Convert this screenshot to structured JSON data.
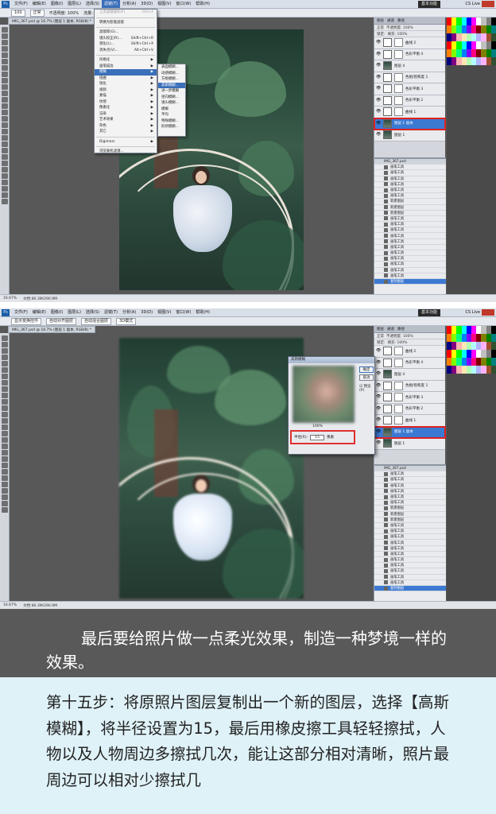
{
  "screenshot1": {
    "menu": [
      "文件(F)",
      "编辑(E)",
      "图像(I)",
      "图层(L)",
      "选择(S)",
      "滤镜(T)",
      "分析(A)",
      "3D(D)",
      "视图(V)",
      "窗口(W)",
      "帮助(H)"
    ],
    "active_menu": "滤镜(T)",
    "workspace": "基本功能",
    "workspace_tabs": [
      "设计",
      "绘画",
      "摄影"
    ],
    "cs_live": "CS Live",
    "options": {
      "size": "100",
      "mode": "正常",
      "opacity": "不透明度: 100%",
      "flow": "流量: 100%"
    },
    "doc_tab": "IMG_367.psd @ 16.7% (图层 1 副本, RGB/8) *",
    "status": {
      "zoom": "16.67%",
      "doc": "文档:80.3M/290.9M"
    },
    "filter_menu": [
      {
        "label": "上次滤镜操作(F)",
        "shortcut": "Ctrl+F",
        "dim": true
      },
      {
        "sep": true
      },
      {
        "label": "转换为智能滤镜",
        "shortcut": ""
      },
      {
        "sep": true
      },
      {
        "label": "滤镜库(G)...",
        "shortcut": ""
      },
      {
        "label": "镜头校正(R)...",
        "shortcut": "Shift+Ctrl+R"
      },
      {
        "label": "液化(L)...",
        "shortcut": "Shift+Ctrl+X"
      },
      {
        "label": "消失点(V)...",
        "shortcut": "Alt+Ctrl+V"
      },
      {
        "sep": true
      },
      {
        "label": "风格化",
        "shortcut": "▶"
      },
      {
        "label": "画笔描边",
        "shortcut": "▶"
      },
      {
        "label": "模糊",
        "shortcut": "▶",
        "hl": true
      },
      {
        "label": "扭曲",
        "shortcut": "▶"
      },
      {
        "label": "锐化",
        "shortcut": "▶"
      },
      {
        "label": "视频",
        "shortcut": "▶"
      },
      {
        "label": "素描",
        "shortcut": "▶"
      },
      {
        "label": "纹理",
        "shortcut": "▶"
      },
      {
        "label": "像素化",
        "shortcut": "▶"
      },
      {
        "label": "渲染",
        "shortcut": "▶"
      },
      {
        "label": "艺术效果",
        "shortcut": "▶"
      },
      {
        "label": "杂色",
        "shortcut": "▶"
      },
      {
        "label": "其它",
        "shortcut": "▶"
      },
      {
        "sep": true
      },
      {
        "label": "Digimarc",
        "shortcut": "▶"
      },
      {
        "sep": true
      },
      {
        "label": "浏览联机滤镜...",
        "shortcut": ""
      }
    ],
    "blur_submenu": [
      {
        "label": "表面模糊..."
      },
      {
        "label": "动感模糊..."
      },
      {
        "label": "方框模糊..."
      },
      {
        "label": "高斯模糊...",
        "hl": true
      },
      {
        "label": "进一步模糊"
      },
      {
        "label": "径向模糊..."
      },
      {
        "label": "镜头模糊..."
      },
      {
        "label": "模糊"
      },
      {
        "label": "平均"
      },
      {
        "label": "特殊模糊..."
      },
      {
        "label": "形状模糊..."
      }
    ],
    "layers_header": {
      "blend": "正常",
      "opacity": "不透明度: 100%",
      "fill": "填充: 100%",
      "lock": "锁定:"
    },
    "layers": [
      {
        "name": "曲线 2",
        "selected": false,
        "photo": false
      },
      {
        "name": "色彩平衡 4",
        "selected": false,
        "photo": false
      },
      {
        "name": "图层 4",
        "selected": false,
        "photo": true
      },
      {
        "name": "色相/饱和度 1",
        "selected": false,
        "photo": false
      },
      {
        "name": "色彩平衡 3",
        "selected": false,
        "photo": false
      },
      {
        "name": "色彩平衡 2",
        "selected": false,
        "photo": false
      },
      {
        "name": "曲线 1",
        "selected": false,
        "photo": false
      },
      {
        "name": "图层 1 副本",
        "selected": true,
        "photo": true
      },
      {
        "name": "图层 1",
        "selected": false,
        "photo": true
      }
    ],
    "history_title": "IMG_367.psd",
    "history": [
      "画笔工具",
      "画笔工具",
      "画笔工具",
      "画笔工具",
      "画笔工具",
      "画笔工具",
      "新建图层",
      "新建图层",
      "新建图层",
      "画笔工具",
      "画笔工具",
      "画笔工具",
      "画笔工具",
      "画笔工具",
      "画笔工具",
      "画笔工具",
      "画笔工具",
      "画笔工具",
      "画笔工具",
      "画笔工具",
      "复制图层"
    ]
  },
  "screenshot2": {
    "menu": [
      "文件(F)",
      "编辑(E)",
      "图像(I)",
      "图层(L)",
      "选择(S)",
      "滤镜(T)",
      "分析(A)",
      "3D(D)",
      "视图(V)",
      "窗口(W)",
      "帮助(H)"
    ],
    "workspace": "基本功能",
    "cs_live": "CS Live",
    "options_buttons": [
      "显示变换控件",
      "自动对齐图层",
      "自动混合图层",
      "3D模式"
    ],
    "doc_tab": "IMG_367.psd @ 16.7% (图层 1 副本, RGB/8) *",
    "status": {
      "zoom": "16.67%",
      "doc": "文档:80.3M/290.9M"
    },
    "gaussian_dialog": {
      "title": "高斯模糊",
      "ok": "确定",
      "cancel": "取消",
      "preview_label": "预览(P)",
      "zoom": "100%",
      "radius_label": "半径(R):",
      "radius_value": "15",
      "unit": "像素"
    },
    "layers": [
      {
        "name": "曲线 2",
        "selected": false,
        "photo": false
      },
      {
        "name": "色彩平衡 4",
        "selected": false,
        "photo": false
      },
      {
        "name": "图层 4",
        "selected": false,
        "photo": true
      },
      {
        "name": "色相/饱和度 1",
        "selected": false,
        "photo": false
      },
      {
        "name": "色彩平衡 3",
        "selected": false,
        "photo": false
      },
      {
        "name": "色彩平衡 2",
        "selected": false,
        "photo": false
      },
      {
        "name": "曲线 1",
        "selected": false,
        "photo": false
      },
      {
        "name": "图层 1 副本",
        "selected": true,
        "photo": true
      },
      {
        "name": "图层 1",
        "selected": false,
        "photo": true
      }
    ],
    "history_title": "IMG_367.psd",
    "history": [
      "画笔工具",
      "画笔工具",
      "画笔工具",
      "画笔工具",
      "画笔工具",
      "画笔工具",
      "新建图层",
      "新建图层",
      "新建图层",
      "画笔工具",
      "画笔工具",
      "画笔工具",
      "画笔工具",
      "画笔工具",
      "画笔工具",
      "画笔工具",
      "画笔工具",
      "画笔工具",
      "画笔工具",
      "画笔工具",
      "复制图层"
    ]
  },
  "caption": "最后要给照片做一点柔光效果，制造一种梦境一样的效果。",
  "step_text": "第十五步：将原照片图层复制出一个新的图层，选择【高斯模糊】，将半径设置为15，最后用橡皮擦工具轻轻擦拭，人物以及人物周边多擦拭几次，能让这部分相对清晰，照片最周边可以相对少擦拭几",
  "colors": {
    "highlight": "#e03030",
    "selection": "#3b79d2",
    "caption_bg": "#595959",
    "text_bg": "#dff2f8"
  }
}
